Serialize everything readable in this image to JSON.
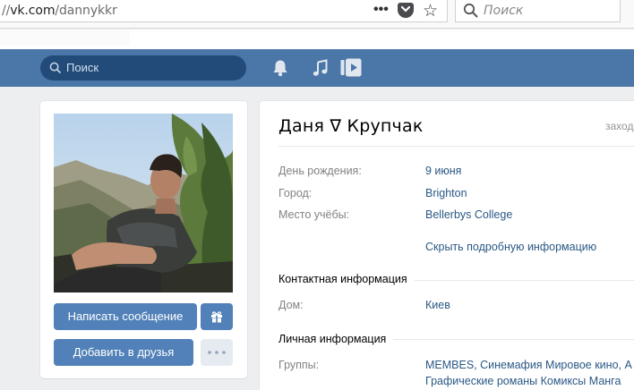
{
  "browser": {
    "url_prefix": "//",
    "url_domain": "vk.com",
    "url_path": "/dannykkr",
    "more_label": "•••",
    "search_placeholder": "Поиск"
  },
  "vk_header": {
    "search_placeholder": "Поиск",
    "icons": [
      "bell-icon",
      "music-icon",
      "play-icon"
    ],
    "accent_color": "#4a76a8"
  },
  "profile": {
    "name": "Даня ∇ Крупчак",
    "online_status": "заход",
    "info": [
      {
        "label": "День рождения:",
        "value": "9 июня"
      },
      {
        "label": "Город:",
        "value": "Brighton"
      },
      {
        "label": "Место учёбы:",
        "value": "Bellerbys College"
      }
    ],
    "hide_details_link": "Скрыть подробную информацию",
    "contact_section": {
      "title": "Контактная информация",
      "rows": [
        {
          "label": "Дом:",
          "value": "Киев"
        }
      ]
    },
    "personal_section": {
      "title": "Личная информация",
      "groups_label": "Группы:",
      "groups_line1": "MEMBES, Синемафия Мировое кино, А",
      "groups_line2": "Графические романы Комиксы Манга"
    }
  },
  "actions": {
    "message_button": "Написать сообщение",
    "add_friend_button": "Добавить в друзья",
    "gift_icon": "gift-icon",
    "more_icon": "more-dots-icon"
  }
}
